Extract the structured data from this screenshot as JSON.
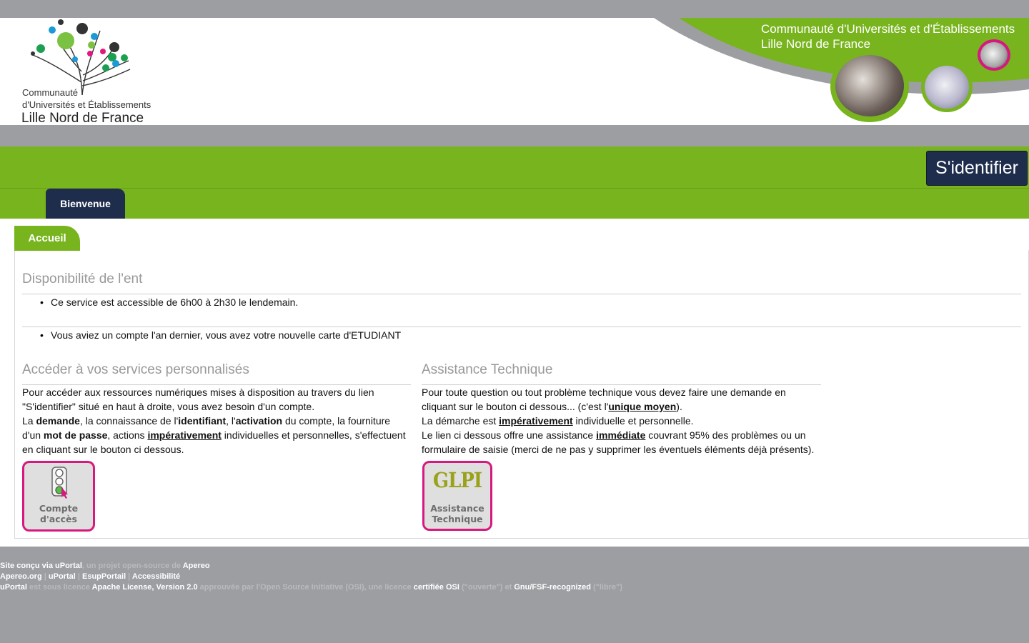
{
  "header": {
    "logo_line1": "Communauté",
    "logo_line2": "d'Universités et Établissements",
    "logo_line3": "Lille Nord de France",
    "banner_line1": "Communauté d'Universités et d'Établissements",
    "banner_line2": "Lille Nord de France"
  },
  "login": {
    "label": "S'identifier"
  },
  "nav": {
    "tabs": [
      {
        "label": "Bienvenue"
      }
    ]
  },
  "page": {
    "tab_label": "Accueil"
  },
  "availability": {
    "title": "Disponibilité de l'ent",
    "item1": "Ce service est accessible de 6h00 à 2h30 le lendemain.",
    "item2": "Vous aviez un compte l'an dernier, vous avez votre nouvelle carte d'ETUDIANT"
  },
  "services": {
    "title": "Accéder à vos services personnalisés",
    "p1": "Pour accéder aux ressources numériques mises à disposition au travers du lien",
    "p2": "\"S'identifier\" situé en haut à droite, vous avez besoin d'un compte.",
    "p3_a": "La ",
    "p3_b": "demande",
    "p3_c": ", la connaissance de l'",
    "p3_d": "identifiant",
    "p3_e": ", l'",
    "p3_f": "activation",
    "p3_g": " du compte, la fourniture",
    "p4_a": "d'un ",
    "p4_b": "mot de passe",
    "p4_c": ", actions ",
    "p4_d": "impérativement",
    "p4_e": " individuelles et personnelles, s'effectuent",
    "p5": "en cliquant sur le bouton ci dessous.",
    "button_line1": "Compte",
    "button_line2": "d'accès"
  },
  "assistance": {
    "title": "Assistance Technique",
    "p1": "Pour toute question ou tout problème technique vous devez faire une demande en",
    "p2_a": "cliquant sur le bouton ci dessous... (c'est l'",
    "p2_b": "unique moyen",
    "p2_c": ").",
    "p3_a": "La démarche est ",
    "p3_b": "impérativement",
    "p3_c": " individuelle et personnelle.",
    "p4_a": "Le lien ci dessous offre une assistance ",
    "p4_b": "immédiate",
    "p4_c": " couvrant 95% des problèmes ou un",
    "p5": "formulaire de saisie (merci de ne pas y supprimer les éventuels éléments déjà présents).",
    "glpi_text": "GLPI",
    "button_line1": "Assistance",
    "button_line2": "Technique"
  },
  "footer": {
    "l1_a": "Site conçu via uPortal",
    "l1_b": ", un projet open-source de ",
    "l1_c": "Apereo",
    "l2_a": "Apereo.org",
    "l2_sep1": " | ",
    "l2_b": "uPortal",
    "l2_sep2": " | ",
    "l2_c": "EsupPortail",
    "l2_sep3": " | ",
    "l2_d": "Accessibilité",
    "l3_a": "uPortal",
    "l3_b": " est sous licence ",
    "l3_c": "Apache License, Version 2.0",
    "l3_d": " approuvée par l'Open Source Initiative (OSI), une licence ",
    "l3_e": "certifiée OSI",
    "l3_f": " (\"ouverte\") et ",
    "l3_g": "Gnu/FSF-recognized",
    "l3_h": " (\"libre\")"
  },
  "colors": {
    "green": "#78b41e",
    "navy": "#1f2d4d",
    "gray": "#9d9ea2",
    "pink": "#d6197f"
  }
}
